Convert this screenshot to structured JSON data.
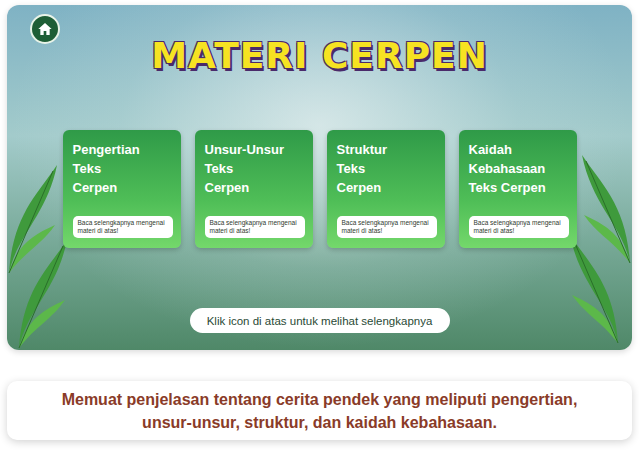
{
  "title": "MATERI CERPEN",
  "cards": [
    {
      "lines": [
        "Pengertian",
        "Teks",
        "Cerpen"
      ],
      "note": "Baca selengkapnya mengenai materi di atas!"
    },
    {
      "lines": [
        "Unsur-Unsur",
        "Teks",
        "Cerpen"
      ],
      "note": "Baca selengkapnya mengenai materi di atas!"
    },
    {
      "lines": [
        "Struktur",
        "Teks",
        "Cerpen"
      ],
      "note": "Baca selengkapnya mengenai materi di atas!"
    },
    {
      "lines": [
        "Kaidah",
        "Kebahasaan",
        "Teks Cerpen"
      ],
      "note": "Baca selengkapnya mengenai materi di atas!"
    }
  ],
  "hint": "Klik icon di atas untuk melihat selengkapnya",
  "caption": [
    "Memuat penjelasan tentang cerita pendek yang meliputi pengertian,",
    "unsur-unsur, struktur, dan kaidah kebahasaan."
  ]
}
